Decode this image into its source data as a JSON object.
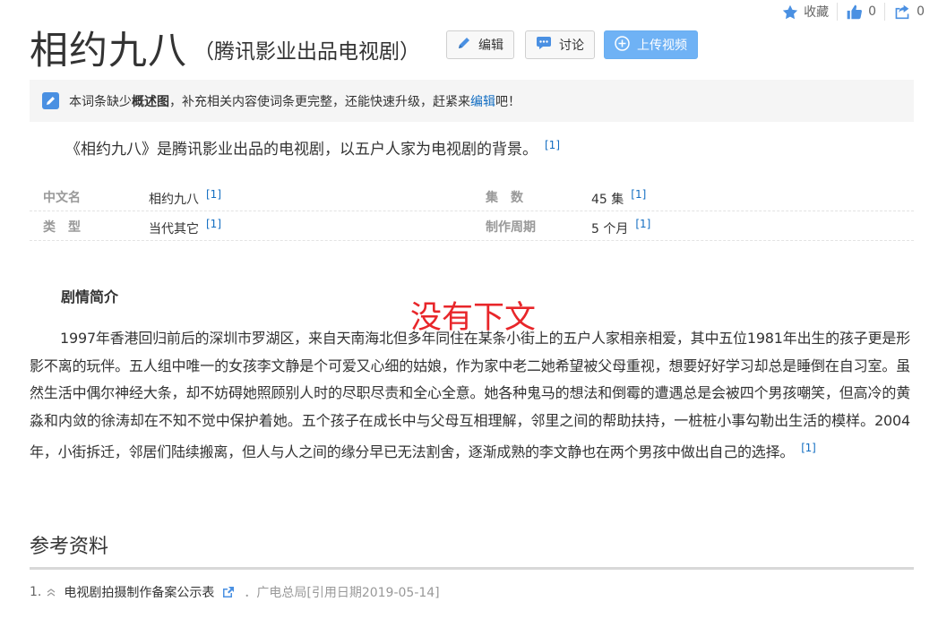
{
  "top_actions": {
    "favorite_label": "收藏",
    "like_count": "0",
    "share_count": "0"
  },
  "title": "相约九八",
  "subtitle": "（腾讯影业出品电视剧）",
  "buttons": {
    "edit": "编辑",
    "discuss": "讨论",
    "upload_video": "上传视频"
  },
  "notice": {
    "part1": "本词条缺少",
    "bold": "概述图",
    "part2": "，补充相关内容使词条更完整，还能快速升级，赶紧来",
    "link": "编辑",
    "part3": "吧！"
  },
  "lemma_summary": {
    "text": "《相约九八》是腾讯影业出品的电视剧，以五户人家为电视剧的背景。",
    "ref": "[1]"
  },
  "basic_info": [
    {
      "label": "中文名",
      "value": "相约九八",
      "ref": "[1]"
    },
    {
      "label": "集　数",
      "value": "45 集",
      "ref": "[1]"
    },
    {
      "label": "类　型",
      "value": "当代其它",
      "ref": "[1]"
    },
    {
      "label": "制作周期",
      "value": "5 个月",
      "ref": "[1]"
    }
  ],
  "plot": {
    "heading": "剧情简介",
    "text": "1997年香港回归前后的深圳市罗湖区，来自天南海北但多年同住在某条小街上的五户人家相亲相爱，其中五位1981年出生的孩子更是形影不离的玩伴。五人组中唯一的女孩李文静是个可爱又心细的姑娘，作为家中老二她希望被父母重视，想要好好学习却总是睡倒在自习室。虽然生活中偶尔神经大条，却不妨碍她照顾别人时的尽职尽责和全心全意。她各种鬼马的想法和倒霉的遭遇总是会被四个男孩嘲笑，但高冷的黄淼和内敛的徐涛却在不知不觉中保护着她。五个孩子在成长中与父母互相理解，邻里之间的帮助扶持，一桩桩小事勾勒出生活的模样。2004年，小街拆迁，邻居们陆续搬离，但人与人之间的缘分早已无法割舍，逐渐成熟的李文静也在两个男孩中做出自己的选择。",
    "ref": "[1]"
  },
  "annotation": "没有下文",
  "references": {
    "heading": "参考资料",
    "items": [
      {
        "number": "1.",
        "title": "电视剧拍摄制作备案公示表",
        "source": "．广电总局[引用日期2019-05-14]"
      }
    ]
  },
  "colors": {
    "link": "#136ec2",
    "primary_button": "#6fb2f5",
    "annotation": "#e8262a",
    "icon_blue": "#4a90e2"
  }
}
